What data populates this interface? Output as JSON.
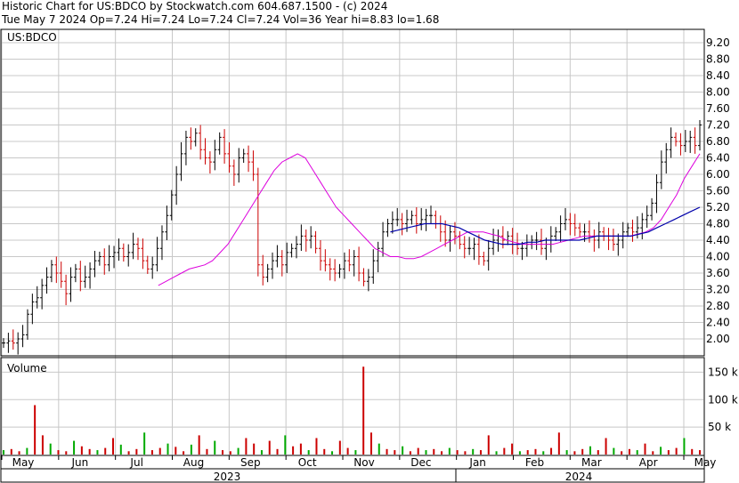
{
  "header": {
    "line1": "Historic Chart for US:BDCO by Stockwatch.com 604.687.1500 - (c) 2024",
    "line2": "Tue May  7 2024  Op=7.24  Hi=7.24  Lo=7.24  Cl=7.24  Vol=36  Year hi=8.83  lo=1.68"
  },
  "colors": {
    "up": "#000000",
    "down": "#cc0000",
    "ma_short": "#dd00dd",
    "ma_long": "#0000aa",
    "vol_up": "#00aa00",
    "vol_down": "#cc0000",
    "grid": "#c8c8c8"
  },
  "chart_data": [
    {
      "type": "ohlc",
      "title": "US:BDCO",
      "ylim": [
        1.68,
        9.4
      ],
      "y_ticks": [
        "9.20",
        "8.80",
        "8.40",
        "8.00",
        "7.60",
        "7.20",
        "6.80",
        "6.40",
        "6.00",
        "5.60",
        "5.20",
        "4.80",
        "4.40",
        "4.00",
        "3.60",
        "3.20",
        "2.80",
        "2.40",
        "2.00"
      ],
      "x_months": [
        "May",
        "Jun",
        "Jul",
        "Aug",
        "Sep",
        "Oct",
        "Nov",
        "Dec",
        "Jan",
        "Feb",
        "Mar",
        "Apr",
        "May"
      ],
      "x_years": [
        "2023",
        "2024"
      ],
      "series": [
        {
          "name": "price",
          "values": [
            1.9,
            1.95,
            1.9,
            2.0,
            2.1,
            2.6,
            2.9,
            3.0,
            3.3,
            3.5,
            3.8,
            3.6,
            3.4,
            3.1,
            3.5,
            3.7,
            3.4,
            3.5,
            3.7,
            3.9,
            4.0,
            3.8,
            4.0,
            4.1,
            4.2,
            4.0,
            4.1,
            4.3,
            4.2,
            3.9,
            3.7,
            3.8,
            4.2,
            4.6,
            5.0,
            5.5,
            6.0,
            6.5,
            6.9,
            6.8,
            7.0,
            6.6,
            6.4,
            6.3,
            6.6,
            6.9,
            6.5,
            6.2,
            6.0,
            6.4,
            6.5,
            6.3,
            6.0,
            3.8,
            3.5,
            3.7,
            3.9,
            4.0,
            3.8,
            4.1,
            4.2,
            4.3,
            4.5,
            4.4,
            4.5,
            4.2,
            3.9,
            3.8,
            3.7,
            3.6,
            3.7,
            3.9,
            3.8,
            4.0,
            3.6,
            3.4,
            3.5,
            3.9,
            4.2,
            4.6,
            4.8,
            4.9,
            4.9,
            4.8,
            4.9,
            5.0,
            4.8,
            4.9,
            5.0,
            5.0,
            4.8,
            4.6,
            4.4,
            4.6,
            4.5,
            4.3,
            4.2,
            4.2,
            4.3,
            4.0,
            3.9,
            4.2,
            4.4,
            4.5,
            4.4,
            4.5,
            4.3,
            4.2,
            4.2,
            4.3,
            4.4,
            4.4,
            4.2,
            4.3,
            4.5,
            4.6,
            4.8,
            4.9,
            4.8,
            4.7,
            4.6,
            4.6,
            4.5,
            4.4,
            4.6,
            4.5,
            4.4,
            4.3,
            4.4,
            4.6,
            4.7,
            4.6,
            4.7,
            4.9,
            5.0,
            5.3,
            5.8,
            6.3,
            6.6,
            6.9,
            6.8,
            6.7,
            6.8,
            6.9,
            6.7,
            7.2
          ]
        },
        {
          "name": "ma_short",
          "values": [
            null,
            null,
            null,
            null,
            null,
            null,
            null,
            null,
            null,
            null,
            null,
            null,
            null,
            null,
            null,
            null,
            null,
            null,
            null,
            null,
            3.3,
            3.4,
            3.5,
            3.6,
            3.7,
            3.75,
            3.8,
            3.9,
            4.1,
            4.3,
            4.6,
            4.9,
            5.2,
            5.5,
            5.8,
            6.1,
            6.3,
            6.4,
            6.5,
            6.4,
            6.1,
            5.8,
            5.5,
            5.2,
            5.0,
            4.8,
            4.6,
            4.4,
            4.2,
            4.1,
            4.0,
            4.0,
            3.95,
            3.95,
            4.0,
            4.1,
            4.2,
            4.3,
            4.4,
            4.5,
            4.6,
            4.6,
            4.6,
            4.55,
            4.5,
            4.4,
            4.35,
            4.3,
            4.3,
            4.3,
            4.3,
            4.3,
            4.35,
            4.4,
            4.45,
            4.5,
            4.5,
            4.5,
            4.5,
            4.5,
            4.5,
            4.5,
            4.55,
            4.6,
            4.7,
            4.9,
            5.2,
            5.5,
            5.9,
            6.2,
            6.5
          ]
        },
        {
          "name": "ma_long",
          "values": [
            null,
            null,
            null,
            null,
            null,
            null,
            null,
            null,
            null,
            null,
            null,
            null,
            null,
            null,
            null,
            null,
            null,
            null,
            null,
            null,
            null,
            null,
            null,
            null,
            null,
            null,
            null,
            null,
            null,
            null,
            null,
            null,
            null,
            null,
            null,
            null,
            null,
            null,
            null,
            null,
            null,
            null,
            null,
            null,
            null,
            4.6,
            4.65,
            4.7,
            4.75,
            4.8,
            4.8,
            4.8,
            4.75,
            4.7,
            4.6,
            4.5,
            4.4,
            4.35,
            4.3,
            4.3,
            4.3,
            4.35,
            4.35,
            4.4,
            4.4,
            4.4,
            4.4,
            4.4,
            4.45,
            4.5,
            4.5,
            4.5,
            4.5,
            4.5,
            4.55,
            4.6,
            4.7,
            4.8,
            4.9,
            5.0,
            5.1,
            5.2
          ]
        }
      ]
    },
    {
      "type": "bar",
      "title": "Volume",
      "y_ticks": [
        "150 k",
        "100 k",
        "50 k"
      ],
      "ylim": [
        0,
        175
      ],
      "series": [
        {
          "name": "volume",
          "values": [
            8,
            10,
            6,
            12,
            90,
            35,
            20,
            8,
            6,
            25,
            15,
            10,
            8,
            12,
            30,
            18,
            6,
            10,
            40,
            8,
            12,
            20,
            14,
            6,
            18,
            35,
            10,
            25,
            8,
            6,
            12,
            30,
            20,
            8,
            25,
            10,
            35,
            15,
            20,
            8,
            30,
            10,
            6,
            25,
            12,
            8,
            160,
            40,
            20,
            10,
            8,
            15,
            6,
            12,
            8,
            10,
            6,
            12,
            8,
            6,
            10,
            8,
            35,
            6,
            12,
            20,
            6,
            8,
            10,
            6,
            12,
            40,
            8,
            6,
            10,
            15,
            8,
            30,
            12,
            6,
            10,
            8,
            20,
            6,
            14,
            8,
            12,
            30,
            10,
            8
          ]
        }
      ]
    }
  ]
}
